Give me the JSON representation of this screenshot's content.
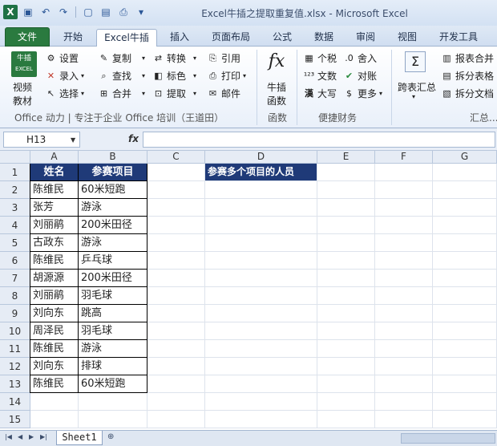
{
  "window": {
    "title": "Excel牛插之提取重复值.xlsx - Microsoft Excel"
  },
  "quick_access": {
    "icons": [
      "excel-logo-icon",
      "save-icon",
      "undo-icon",
      "redo-icon",
      "new-icon",
      "open-icon",
      "print-preview-icon",
      "customize-icon"
    ]
  },
  "tabs": [
    "文件",
    "开始",
    "Excel牛插",
    "插入",
    "页面布局",
    "公式",
    "数据",
    "审阅",
    "视图",
    "开发工具"
  ],
  "ribbon": {
    "logo_top": "牛插",
    "logo_bottom": "EXCEL",
    "video_line1": "视频",
    "video_line2": "教材",
    "settings": "设置",
    "record": "录入",
    "select": "选择",
    "copy": "复制",
    "find": "查找",
    "merge": "合并",
    "convert": "转换",
    "mark": "标色",
    "extract": "提取",
    "quote": "引用",
    "print": "打印",
    "mail": "邮件",
    "fx_line1": "牛插",
    "fx_line2": "函数",
    "tax": "个税",
    "text": "文数",
    "upper": "大写",
    "round": "舍入",
    "check": "对账",
    "more": "更多",
    "cross_table": "跨表汇总",
    "report_merge": "报表合并",
    "split_table": "拆分表格",
    "split_doc": "拆分文档",
    "group_office": "Office 动力 | 专注于企业 Office 培训（王道田）",
    "group_func": "函数",
    "group_finance": "便捷财务",
    "group_summary": "汇总..."
  },
  "formula_bar": {
    "name_box": "H13",
    "fx": "fx",
    "value": ""
  },
  "columns": [
    "A",
    "B",
    "C",
    "D",
    "E",
    "F",
    "G"
  ],
  "rows": [
    "1",
    "2",
    "3",
    "4",
    "5",
    "6",
    "7",
    "8",
    "9",
    "10",
    "11",
    "12",
    "13",
    "14",
    "15"
  ],
  "table": {
    "header_name": "姓名",
    "header_item": "参赛项目",
    "d1": "参赛多个项目的人员",
    "data": [
      [
        "陈维民",
        "60米短跑"
      ],
      [
        "张芳",
        "游泳"
      ],
      [
        "刘丽鹃",
        "200米田径"
      ],
      [
        "古政东",
        "游泳"
      ],
      [
        "陈维民",
        "乒乓球"
      ],
      [
        "胡源源",
        "200米田径"
      ],
      [
        "刘丽鹃",
        "羽毛球"
      ],
      [
        "刘向东",
        "跳高"
      ],
      [
        "周泽民",
        "羽毛球"
      ],
      [
        "陈维民",
        "游泳"
      ],
      [
        "刘向东",
        "排球"
      ],
      [
        "陈维民",
        "60米短跑"
      ]
    ]
  },
  "sheet_tabs": [
    "Sheet1"
  ],
  "colors": {
    "header_fill": "#1f3a78",
    "file_tab": "#2a7a3f"
  }
}
